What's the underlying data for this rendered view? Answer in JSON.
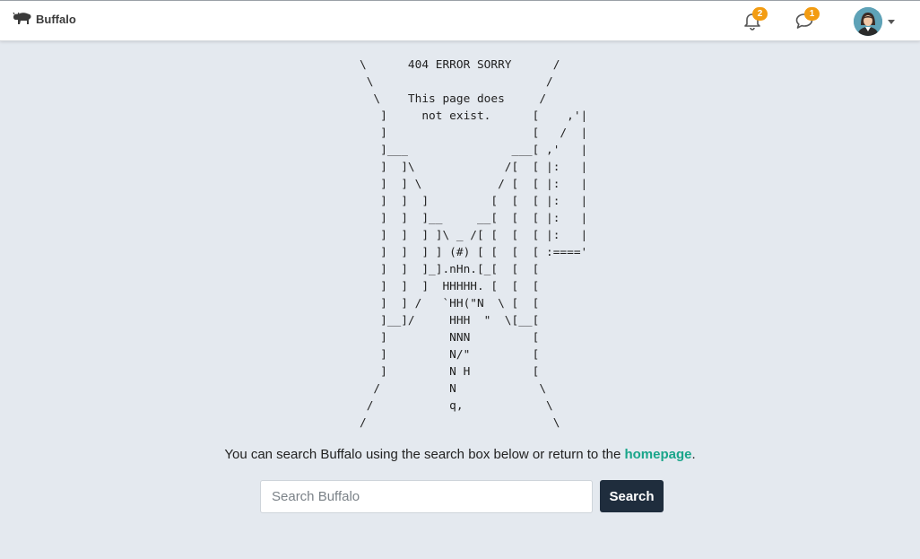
{
  "navbar": {
    "brand_label": "Buffalo",
    "brand_icon": "buffalo-icon",
    "notifications": {
      "icon": "bell-icon",
      "count": "2"
    },
    "messages": {
      "icon": "chat-bubble-icon",
      "count": "1"
    },
    "user": {
      "icon": "avatar",
      "menu_icon": "chevron-down-icon"
    }
  },
  "error": {
    "ascii_art": "\\      404 ERROR SORRY      /\n \\                         /\n  \\    This page does     /\n   ]     not exist.      [    ,'|\n   ]                     [   /  |\n   ]___               ___[ ,'   |\n   ]  ]\\             /[  [ |:   |\n   ]  ] \\           / [  [ |:   |\n   ]  ]  ]         [  [  [ |:   |\n   ]  ]  ]__     __[  [  [ |:   |\n   ]  ]  ] ]\\ _ /[ [  [  [ |:   |\n   ]  ]  ] ] (#) [ [  [  [ :===='\n   ]  ]  ]_].nHn.[_[  [  [\n   ]  ]  ]  HHHHH. [  [  [\n   ]  ] /   `HH(\"N  \\ [  [\n   ]__]/     HHH  \"  \\[__[\n   ]         NNN         [\n   ]         N/\"         [\n   ]         N H         [\n  /          N            \\\n /           q,            \\\n/                           \\"
  },
  "message": {
    "text": "You can search Buffalo using the search box below or return to the ",
    "link_label": "homepage",
    "suffix": "."
  },
  "search": {
    "placeholder": "Search Buffalo",
    "value": "",
    "button_label": "Search"
  },
  "colors": {
    "background": "#e4e9ef",
    "link": "#19a58a",
    "badge": "#f39c12",
    "button": "#1f2d3d"
  }
}
